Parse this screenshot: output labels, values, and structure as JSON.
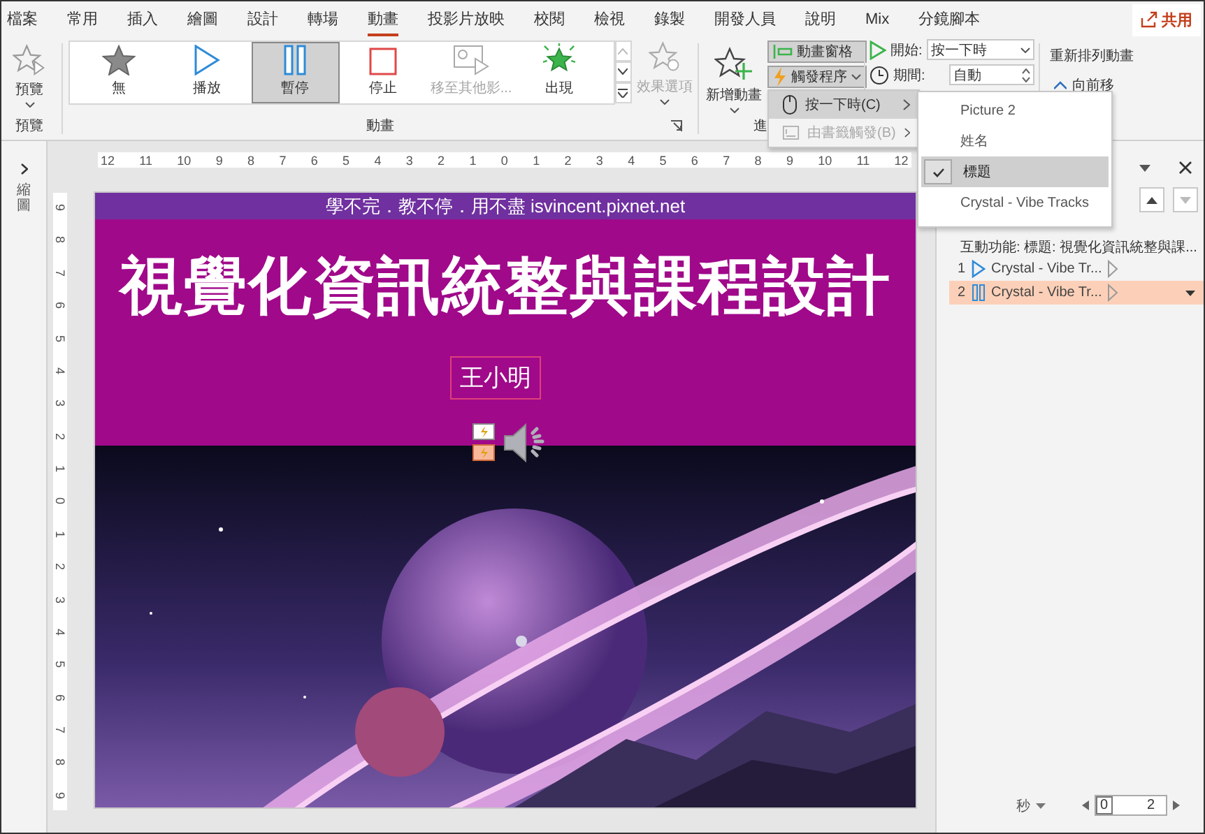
{
  "menu_tabs": [
    {
      "label": "檔案",
      "selected": false
    },
    {
      "label": "常用",
      "selected": false
    },
    {
      "label": "插入",
      "selected": false
    },
    {
      "label": "繪圖",
      "selected": false
    },
    {
      "label": "設計",
      "selected": false
    },
    {
      "label": "轉場",
      "selected": false
    },
    {
      "label": "動畫",
      "selected": true
    },
    {
      "label": "投影片放映",
      "selected": false
    },
    {
      "label": "校閱",
      "selected": false
    },
    {
      "label": "檢視",
      "selected": false
    },
    {
      "label": "錄製",
      "selected": false
    },
    {
      "label": "開發人員",
      "selected": false
    },
    {
      "label": "說明",
      "selected": false
    },
    {
      "label": "Mix",
      "selected": false
    },
    {
      "label": "分鏡腳本",
      "selected": false
    }
  ],
  "share_button": {
    "label": "共用"
  },
  "ribbon": {
    "preview": {
      "button": "預覽",
      "group_label": "預覽"
    },
    "gallery": {
      "group_label": "動畫",
      "items": [
        {
          "label": "無",
          "kind": "none",
          "selected": false,
          "disabled": false
        },
        {
          "label": "播放",
          "kind": "play",
          "selected": false,
          "disabled": false
        },
        {
          "label": "暫停",
          "kind": "pause",
          "selected": true,
          "disabled": false
        },
        {
          "label": "停止",
          "kind": "stop",
          "selected": false,
          "disabled": false
        },
        {
          "label": "移至其他影...",
          "kind": "seek",
          "selected": false,
          "disabled": true
        },
        {
          "label": "出現",
          "kind": "appear",
          "selected": false,
          "disabled": false
        }
      ]
    },
    "effect_options": {
      "label": "效果選項",
      "disabled": true
    },
    "advanced": {
      "add_animation": "新增動畫",
      "animation_pane": {
        "label": "動畫窗格",
        "selected": true
      },
      "trigger": {
        "label": "觸發程序",
        "selected": true
      },
      "group_label": "進"
    },
    "timing": {
      "start_label": "開始:",
      "start_value": "按一下時",
      "duration_label": "期間:",
      "duration_value": "自動"
    },
    "reorder": {
      "title": "重新排列動畫",
      "move_earlier": "向前移"
    }
  },
  "trigger_menu": {
    "items": [
      {
        "label": "按一下時(C)",
        "kind": "click",
        "selected": true,
        "disabled": false
      },
      {
        "label": "由書籤觸發(B)",
        "kind": "bookmark",
        "selected": false,
        "disabled": true
      }
    ]
  },
  "trigger_submenu": {
    "items": [
      {
        "label": "Picture 2",
        "checked": false
      },
      {
        "label": "姓名",
        "checked": false
      },
      {
        "label": "標題",
        "checked": true
      },
      {
        "label": "Crystal - Vibe Tracks",
        "checked": false
      }
    ]
  },
  "thumbnails_pane": {
    "label": "縮圖"
  },
  "ruler": {
    "horizontal": [
      "12",
      "11",
      "10",
      "9",
      "8",
      "7",
      "6",
      "5",
      "4",
      "3",
      "2",
      "1",
      "0",
      "1",
      "2",
      "3",
      "4",
      "5",
      "6",
      "7",
      "8",
      "9",
      "10",
      "11",
      "12"
    ],
    "vertical": [
      "9",
      "8",
      "7",
      "6",
      "5",
      "4",
      "3",
      "2",
      "1",
      "0",
      "1",
      "2",
      "3",
      "4",
      "5",
      "6",
      "7",
      "8",
      "9"
    ]
  },
  "slide": {
    "banner": "學不完．教不停．用不盡 isvincent.pixnet.net",
    "title": "視覺化資訊統整與課程設計",
    "name": "王小明",
    "trigger_tags": [
      {
        "selected": false
      },
      {
        "selected": true
      }
    ]
  },
  "animation_pane": {
    "trigger_heading": "互動功能: 標題: 視覺化資訊統整與課...",
    "items": [
      {
        "number": "1",
        "kind": "play",
        "label": "Crystal - Vibe Tr...",
        "selected": false
      },
      {
        "number": "2",
        "kind": "pause",
        "label": "Crystal - Vibe Tr...",
        "selected": true
      }
    ],
    "seconds_label": "秒",
    "timeline": [
      "0",
      "2"
    ]
  }
}
